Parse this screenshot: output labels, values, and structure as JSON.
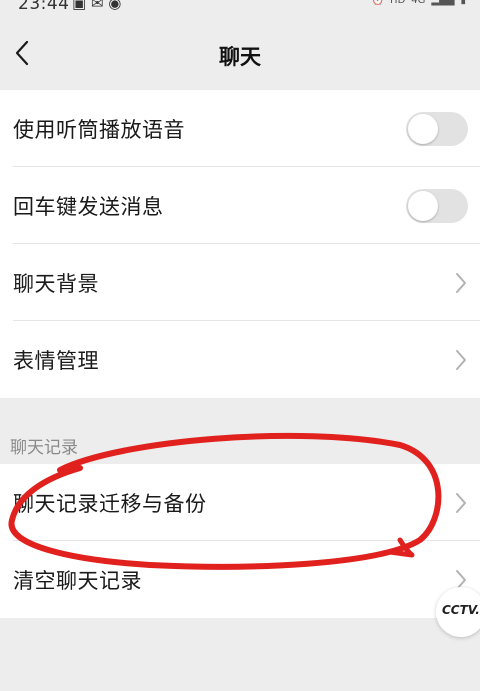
{
  "status_bar": {
    "time": "23:44",
    "network": "HD",
    "signal": "4G"
  },
  "header": {
    "title": "聊天"
  },
  "settings_group_1": {
    "items": [
      {
        "label": "使用听筒播放语音",
        "control": "toggle",
        "state": "off"
      },
      {
        "label": "回车键发送消息",
        "control": "toggle",
        "state": "off"
      },
      {
        "label": "聊天背景",
        "control": "chevron"
      },
      {
        "label": "表情管理",
        "control": "chevron"
      }
    ]
  },
  "chat_history_section": {
    "header": "聊天记录",
    "items": [
      {
        "label": "聊天记录迁移与备份",
        "control": "chevron"
      },
      {
        "label": "清空聊天记录",
        "control": "chevron"
      }
    ]
  },
  "watermark": {
    "text": "CCTV.com"
  },
  "colors": {
    "background": "#ededed",
    "annotation": "#e0211d",
    "toggle_off": "#e2e2e2"
  }
}
